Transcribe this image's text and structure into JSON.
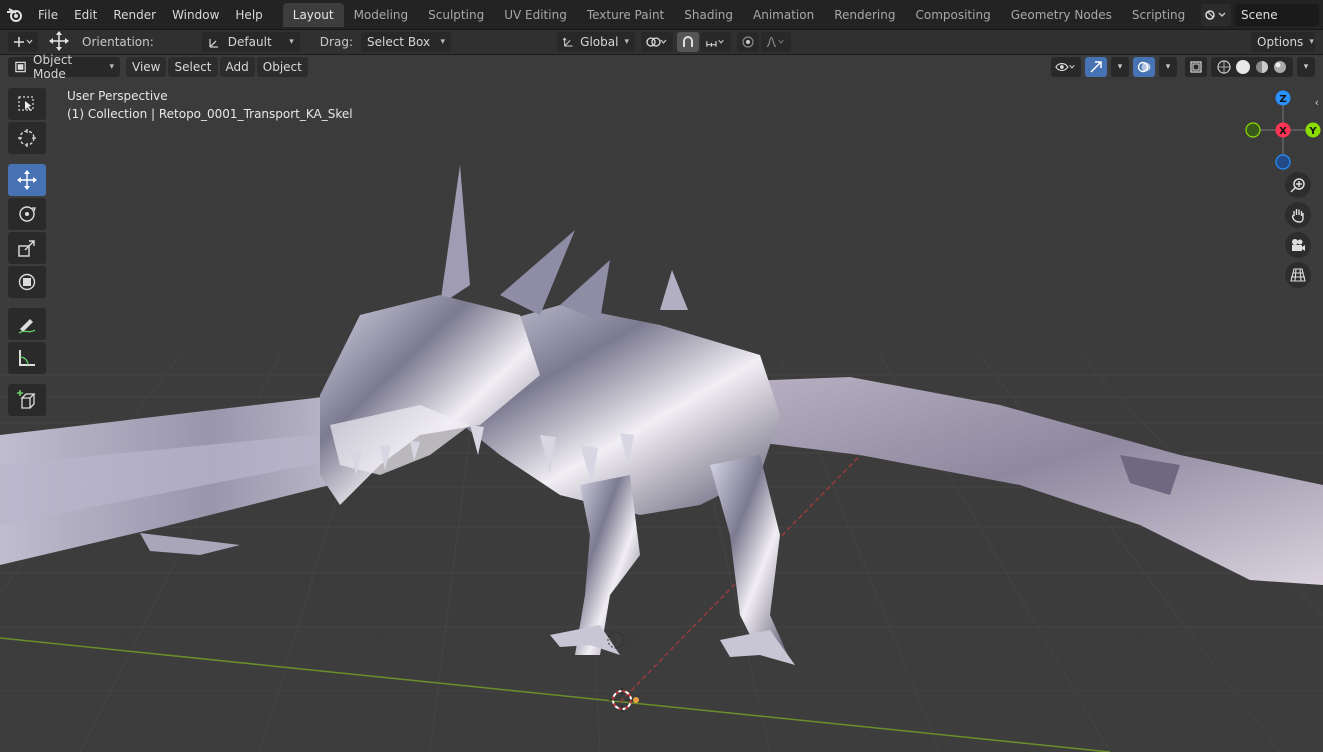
{
  "menu": [
    "File",
    "Edit",
    "Render",
    "Window",
    "Help"
  ],
  "workspaces": [
    "Layout",
    "Modeling",
    "Sculpting",
    "UV Editing",
    "Texture Paint",
    "Shading",
    "Animation",
    "Rendering",
    "Compositing",
    "Geometry Nodes",
    "Scripting"
  ],
  "active_workspace": "Layout",
  "scene": {
    "name": "Scene"
  },
  "toolheader": {
    "orientation_label": "Orientation:",
    "orientation_value": "Default",
    "drag_label": "Drag:",
    "drag_value": "Select Box",
    "transform_orientation": "Global",
    "options_label": "Options"
  },
  "viewport_header": {
    "mode": "Object Mode",
    "menus": [
      "View",
      "Select",
      "Add",
      "Object"
    ]
  },
  "viewport": {
    "view_name": "User Perspective",
    "collection_info": "(1) Collection | Retopo_0001_Transport_KA_Skel"
  },
  "tools": [
    "select-box",
    "cursor",
    "move",
    "rotate",
    "scale",
    "transform",
    "annotate",
    "measure",
    "add-cube"
  ],
  "active_tool": "move",
  "gizmo": {
    "x": "X",
    "y": "Y",
    "z": "Z"
  },
  "colors": {
    "accent": "#4772b3",
    "axis_x": "#ff3352",
    "axis_y": "#8bdc00",
    "axis_z": "#2890ff"
  }
}
